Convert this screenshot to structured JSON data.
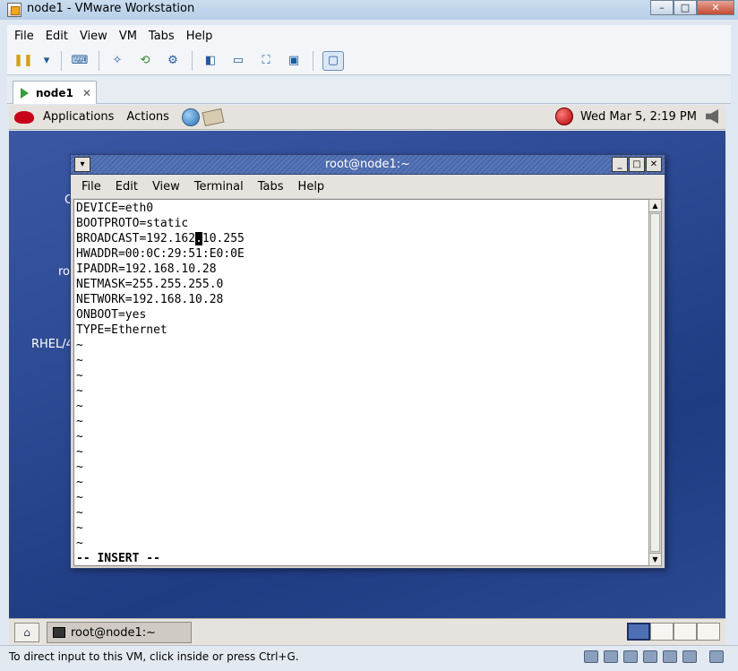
{
  "window": {
    "title": "node1 - VMware Workstation",
    "minimize": "–",
    "maximize": "□",
    "close": "✕"
  },
  "menubar": [
    "File",
    "Edit",
    "View",
    "VM",
    "Tabs",
    "Help"
  ],
  "vm_tab": {
    "label": "node1",
    "close": "✕"
  },
  "gnome_panel": {
    "applications": "Applications",
    "actions": "Actions",
    "clock": "Wed Mar  5,  2:19 PM"
  },
  "desktop_labels": [
    "C",
    "ro",
    "RHEL/4"
  ],
  "terminal": {
    "title": "root@node1:~",
    "menu": [
      "File",
      "Edit",
      "View",
      "Terminal",
      "Tabs",
      "Help"
    ],
    "lines": [
      "DEVICE=eth0",
      "BOOTPROTO=static",
      "BROADCAST=192.162",
      "HWADDR=00:0C:29:51:E0:0E",
      "IPADDR=192.168.10.28",
      "NETMASK=255.255.255.0",
      "NETWORK=192.168.10.28",
      "ONBOOT=yes",
      "TYPE=Ethernet"
    ],
    "cursor_char": ".",
    "broadcast_tail": "10.255",
    "tilde": "~",
    "tilde_count": 14,
    "mode": "-- INSERT --"
  },
  "taskbar": {
    "task_label": "root@node1:~"
  },
  "statusbar": {
    "message": "To direct input to this VM, click inside or press Ctrl+G."
  }
}
